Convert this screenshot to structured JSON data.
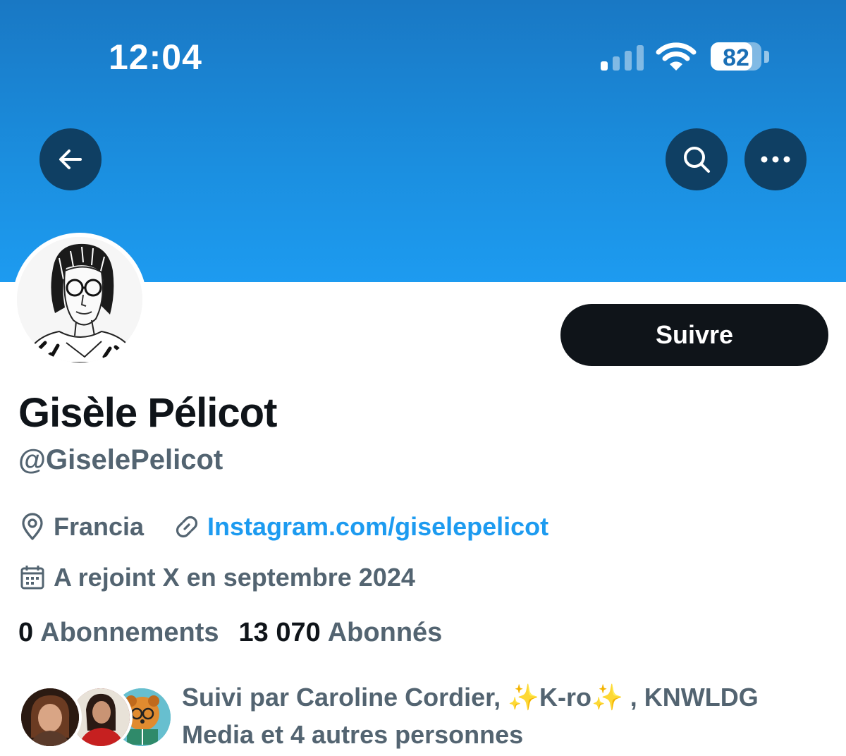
{
  "status_bar": {
    "time": "12:04",
    "battery_percent": "82",
    "battery_level": 0.82,
    "signal_bars_active": 1,
    "signal_bars_total": 4
  },
  "nav": {
    "back_icon": "arrow-left-icon",
    "search_icon": "search-icon",
    "more_icon": "more-horizontal-icon"
  },
  "colors": {
    "banner": "#1d9bf0",
    "link": "#1d9bf0",
    "secondary_text": "#536471",
    "primary_text": "#0f1419"
  },
  "profile": {
    "follow_label": "Suivre",
    "display_name": "Gisèle Pélicot",
    "handle": "@GiselePelicot",
    "location": "Francia",
    "website": "Instagram.com/giselepelicot",
    "joined": "A rejoint X en septembre 2024"
  },
  "stats": {
    "following_count": "0",
    "following_label": "Abonnements",
    "followers_count": "13 070",
    "followers_label": "Abonnés"
  },
  "followed_by": {
    "text": "Suivi par Caroline Cordier, ✨K-ro✨ , KNWLDG Media et 4 autres personnes"
  }
}
